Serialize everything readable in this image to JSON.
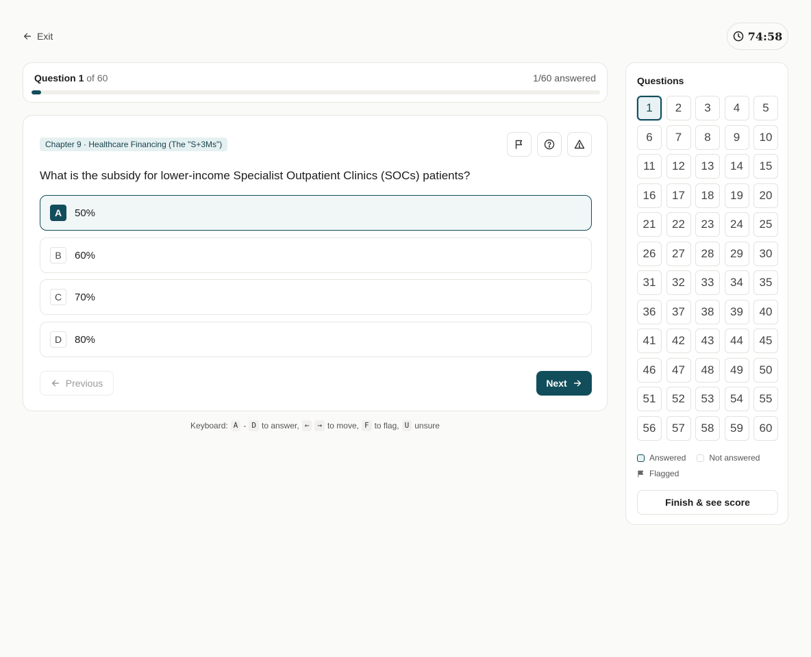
{
  "header": {
    "exit_label": "Exit",
    "timer": "74:58"
  },
  "progress": {
    "question_prefix": "Question",
    "current": "1",
    "of_total": "of 60",
    "answered_text": "1/60 answered",
    "fraction": 0.0167
  },
  "question": {
    "chapter": "Chapter 9 · Healthcare Financing (The \"S+3Ms\")",
    "text": "What is the subsidy for lower-income Specialist Outpatient Clinics (SOCs) patients?",
    "options": [
      {
        "letter": "A",
        "text": "50%"
      },
      {
        "letter": "B",
        "text": "60%"
      },
      {
        "letter": "C",
        "text": "70%"
      },
      {
        "letter": "D",
        "text": "80%"
      }
    ],
    "selected": "A"
  },
  "nav": {
    "previous_label": "Previous",
    "next_label": "Next"
  },
  "keyboard_hint": {
    "prefix": "Keyboard:",
    "key_a": "A",
    "dash": "-",
    "key_d": "D",
    "answer_text": "to answer,",
    "key_left": "←",
    "key_right": "→",
    "move_text": "to move,",
    "key_f": "F",
    "flag_text": "to flag,",
    "key_u": "U",
    "unsure_text": "unsure"
  },
  "sidebar": {
    "title": "Questions",
    "numbers": [
      "1",
      "2",
      "3",
      "4",
      "5",
      "6",
      "7",
      "8",
      "9",
      "10",
      "11",
      "12",
      "13",
      "14",
      "15",
      "16",
      "17",
      "18",
      "19",
      "20",
      "21",
      "22",
      "23",
      "24",
      "25",
      "26",
      "27",
      "28",
      "29",
      "30",
      "31",
      "32",
      "33",
      "34",
      "35",
      "36",
      "37",
      "38",
      "39",
      "40",
      "41",
      "42",
      "43",
      "44",
      "45",
      "46",
      "47",
      "48",
      "49",
      "50",
      "51",
      "52",
      "53",
      "54",
      "55",
      "56",
      "57",
      "58",
      "59",
      "60"
    ],
    "current_index": 0,
    "legend_answered": "Answered",
    "legend_not_answered": "Not answered",
    "legend_flagged": "Flagged",
    "finish_label": "Finish & see score"
  },
  "colors": {
    "accent": "#124d5b",
    "accent_light": "#e8f1f3",
    "background": "#fafaf8"
  }
}
